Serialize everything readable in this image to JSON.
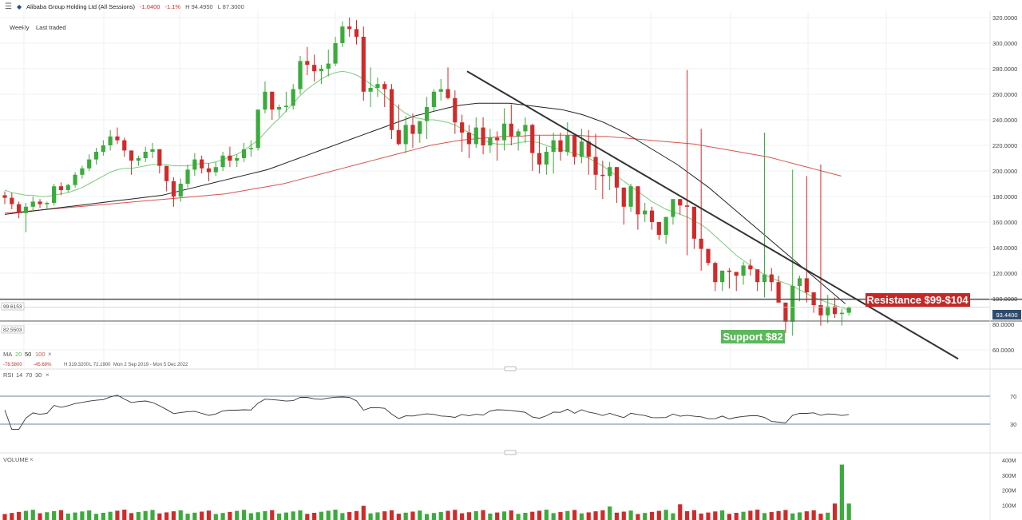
{
  "header": {
    "menu_icon": "hamburger-icon",
    "symbol_icon": "diamond-icon",
    "symbol": "Alibaba Group Holding Ltd (All Sessions)",
    "change": "-1.0400",
    "change_pct": "-1.1%",
    "high": "H 94.4950",
    "low": "L 87.3000"
  },
  "toolbar": {
    "interval": "Weekly",
    "price_mode": "Last traded"
  },
  "price_axis": {
    "ticks": [
      "320.0000",
      "300.0000",
      "280.0000",
      "260.0000",
      "240.0000",
      "220.0000",
      "200.0000",
      "180.0000",
      "160.0000",
      "140.0000",
      "120.0000",
      "100.0000",
      "80.0000",
      "60.0000"
    ],
    "current_price": "93.4400",
    "line_left_a": "99.6153",
    "line_left_b": "82.5503"
  },
  "annotations": {
    "resistance": "Resistance $99-$104",
    "support": "Support $82"
  },
  "ma_legend": {
    "label": "MA",
    "p1": "20",
    "p2": "50",
    "p3": "100",
    "close": "×",
    "stat1": "-78.5800",
    "stat2": "-45.68%",
    "stat3": "H 319.3200",
    "stat4": "L 72.1900",
    "range": "Mon 2 Sep 2019 - Mon 5 Dec 2022"
  },
  "rsi": {
    "label": "RSI",
    "p1": "14",
    "p2": "70",
    "p3": "30",
    "close": "×",
    "upper": "70",
    "lower": "30"
  },
  "volume": {
    "label": "VOLUME",
    "close": "×",
    "ticks": [
      "400M",
      "300M",
      "200M",
      "100M"
    ]
  },
  "colors": {
    "up": "#3bab3b",
    "down": "#d12a2a",
    "ma20": "#7ccb7c",
    "ma50": "#222222",
    "ma100": "#d9534f",
    "rsi_line": "#333333",
    "rsi_band": "#3d5a80"
  },
  "chart_data": {
    "type": "candlestick",
    "interval": "Weekly",
    "ylim": [
      50,
      320
    ],
    "trendline": {
      "from": [
        585,
        278
      ],
      "to": [
        1200,
        53
      ]
    },
    "resistance_level": 99.6153,
    "support_level": 82.5503,
    "last_price": 93.44,
    "candles": [
      [
        181,
        184,
        174,
        179
      ],
      [
        179,
        183,
        170,
        174
      ],
      [
        174,
        176,
        163,
        167
      ],
      [
        167,
        175,
        152,
        172
      ],
      [
        172,
        180,
        168,
        176
      ],
      [
        176,
        178,
        171,
        174
      ],
      [
        174,
        176,
        170,
        175
      ],
      [
        175,
        190,
        173,
        188
      ],
      [
        188,
        191,
        181,
        185
      ],
      [
        185,
        190,
        183,
        189
      ],
      [
        189,
        199,
        187,
        197
      ],
      [
        197,
        204,
        194,
        202
      ],
      [
        202,
        213,
        200,
        209
      ],
      [
        209,
        218,
        205,
        215
      ],
      [
        215,
        224,
        212,
        220
      ],
      [
        220,
        232,
        216,
        227
      ],
      [
        227,
        234,
        221,
        224
      ],
      [
        224,
        226,
        211,
        216
      ],
      [
        216,
        214,
        197,
        208
      ],
      [
        208,
        212,
        204,
        210
      ],
      [
        210,
        219,
        207,
        215
      ],
      [
        215,
        222,
        210,
        217
      ],
      [
        217,
        211,
        198,
        204
      ],
      [
        204,
        200,
        184,
        192
      ],
      [
        192,
        195,
        172,
        180
      ],
      [
        180,
        194,
        176,
        190
      ],
      [
        190,
        205,
        187,
        201
      ],
      [
        201,
        214,
        196,
        209
      ],
      [
        209,
        212,
        198,
        202
      ],
      [
        202,
        206,
        192,
        199
      ],
      [
        199,
        207,
        196,
        203
      ],
      [
        203,
        215,
        200,
        212
      ],
      [
        212,
        219,
        203,
        208
      ],
      [
        208,
        213,
        203,
        210
      ],
      [
        210,
        222,
        207,
        217
      ],
      [
        217,
        224,
        211,
        218
      ],
      [
        218,
        241,
        216,
        248
      ],
      [
        248,
        270,
        245,
        262
      ],
      [
        262,
        257,
        240,
        248
      ],
      [
        248,
        252,
        242,
        250
      ],
      [
        250,
        262,
        246,
        251
      ],
      [
        251,
        268,
        248,
        264
      ],
      [
        264,
        290,
        260,
        286
      ],
      [
        286,
        297,
        275,
        283
      ],
      [
        283,
        291,
        270,
        278
      ],
      [
        278,
        283,
        268,
        280
      ],
      [
        280,
        295,
        274,
        284
      ],
      [
        284,
        305,
        282,
        300
      ],
      [
        300,
        317,
        297,
        313
      ],
      [
        313,
        320,
        305,
        311
      ],
      [
        311,
        318,
        299,
        305
      ],
      [
        305,
        313,
        255,
        262
      ],
      [
        262,
        281,
        250,
        265
      ],
      [
        265,
        273,
        258,
        268
      ],
      [
        268,
        270,
        250,
        264
      ],
      [
        264,
        268,
        225,
        232
      ],
      [
        232,
        252,
        220,
        221
      ],
      [
        221,
        243,
        214,
        236
      ],
      [
        236,
        245,
        218,
        229
      ],
      [
        229,
        238,
        222,
        239
      ],
      [
        239,
        258,
        225,
        250
      ],
      [
        250,
        264,
        247,
        262
      ],
      [
        262,
        272,
        255,
        264
      ],
      [
        264,
        281,
        256,
        257
      ],
      [
        257,
        263,
        229,
        238
      ],
      [
        238,
        244,
        215,
        230
      ],
      [
        230,
        236,
        210,
        221
      ],
      [
        221,
        242,
        218,
        234
      ],
      [
        234,
        242,
        213,
        220
      ],
      [
        220,
        233,
        214,
        226
      ],
      [
        226,
        231,
        208,
        224
      ],
      [
        224,
        249,
        216,
        237
      ],
      [
        237,
        252,
        220,
        227
      ],
      [
        227,
        233,
        216,
        231
      ],
      [
        231,
        242,
        222,
        236
      ],
      [
        236,
        237,
        200,
        214
      ],
      [
        214,
        228,
        198,
        205
      ],
      [
        205,
        219,
        197,
        215
      ],
      [
        215,
        230,
        198,
        224
      ],
      [
        224,
        230,
        208,
        215
      ],
      [
        215,
        238,
        212,
        228
      ],
      [
        228,
        229,
        205,
        211
      ],
      [
        211,
        233,
        206,
        223
      ],
      [
        223,
        232,
        197,
        211
      ],
      [
        211,
        229,
        185,
        197
      ],
      [
        197,
        208,
        178,
        196
      ],
      [
        196,
        207,
        185,
        203
      ],
      [
        203,
        202,
        175,
        187
      ],
      [
        187,
        182,
        158,
        172
      ],
      [
        172,
        190,
        168,
        188
      ],
      [
        188,
        186,
        154,
        166
      ],
      [
        166,
        175,
        160,
        169
      ],
      [
        169,
        172,
        154,
        160
      ],
      [
        160,
        156,
        146,
        150
      ],
      [
        150,
        163,
        143,
        164
      ],
      [
        164,
        173,
        158,
        178
      ],
      [
        178,
        176,
        166,
        173
      ],
      [
        173,
        279,
        134,
        172
      ],
      [
        172,
        167,
        139,
        147
      ],
      [
        147,
        233,
        122,
        139
      ],
      [
        139,
        138,
        126,
        128
      ],
      [
        128,
        129,
        106,
        113
      ],
      [
        113,
        117,
        106,
        122
      ],
      [
        122,
        124,
        108,
        121
      ],
      [
        121,
        117,
        106,
        118
      ],
      [
        118,
        129,
        111,
        126
      ],
      [
        126,
        131,
        118,
        123
      ],
      [
        123,
        122,
        106,
        113
      ],
      [
        113,
        230,
        101,
        119
      ],
      [
        119,
        124,
        106,
        113
      ],
      [
        113,
        118,
        97,
        97
      ],
      [
        97,
        82,
        73,
        82
      ],
      [
        82,
        201,
        71,
        110
      ],
      [
        110,
        118,
        98,
        116
      ],
      [
        116,
        196,
        97,
        105
      ],
      [
        105,
        101,
        89,
        95
      ],
      [
        95,
        205,
        79,
        87
      ],
      [
        87,
        103,
        81,
        94
      ],
      [
        94,
        101,
        85,
        88
      ],
      [
        88,
        92,
        79,
        89
      ],
      [
        89,
        94,
        87,
        93
      ]
    ],
    "ma20": [
      185,
      183,
      182,
      181,
      181,
      180,
      180,
      181,
      182,
      183,
      185,
      187,
      190,
      193,
      196,
      199,
      201,
      202,
      202,
      203,
      204,
      205,
      205,
      205,
      204,
      204,
      204,
      205,
      206,
      206,
      207,
      209,
      211,
      213,
      216,
      220,
      224,
      230,
      236,
      241,
      247,
      253,
      259,
      264,
      268,
      272,
      275,
      277,
      278,
      277,
      275,
      272,
      268,
      264,
      259,
      254,
      249,
      245,
      242,
      241,
      240,
      240,
      239,
      238,
      236,
      233,
      230,
      227,
      224,
      222,
      221,
      221,
      221,
      222,
      223,
      223,
      222,
      220,
      218,
      217,
      215,
      214,
      212,
      210,
      207,
      204,
      200,
      196,
      192,
      188,
      184,
      180,
      176,
      173,
      170,
      168,
      166,
      164,
      161,
      158,
      154,
      149,
      144,
      139,
      134,
      130,
      126,
      122,
      119,
      116,
      114,
      112,
      110,
      107,
      104,
      101,
      99,
      97,
      95,
      93,
      91
    ],
    "ma50": [
      166,
      167,
      168,
      169,
      170,
      171,
      172,
      173,
      174,
      175,
      176,
      177,
      178,
      179,
      180,
      181,
      183,
      185,
      187,
      189,
      191,
      193,
      195,
      197,
      199,
      201,
      204,
      207,
      210,
      213,
      216,
      219,
      222,
      225,
      228,
      231,
      234,
      237,
      240,
      243,
      245,
      247,
      249,
      251,
      252,
      253,
      253,
      253,
      253,
      252,
      251,
      250,
      249,
      248,
      246,
      244,
      241,
      238,
      234,
      230,
      225,
      220,
      215,
      210,
      205,
      199,
      193,
      187,
      180,
      173,
      166,
      159,
      152,
      145,
      138,
      131,
      124,
      117,
      110,
      103,
      96
    ],
    "ma100": [
      167,
      168,
      169,
      170,
      171,
      172,
      173,
      174,
      175,
      176,
      177,
      178,
      179,
      180,
      181,
      182,
      184,
      186,
      188,
      190,
      193,
      196,
      199,
      202,
      205,
      208,
      211,
      214,
      217,
      220,
      222,
      224,
      225,
      226,
      227,
      227,
      228,
      228,
      228,
      228,
      227,
      227,
      226,
      225,
      224,
      223,
      222,
      221,
      219,
      217,
      215,
      213,
      211,
      208,
      205,
      202,
      199,
      196
    ]
  }
}
